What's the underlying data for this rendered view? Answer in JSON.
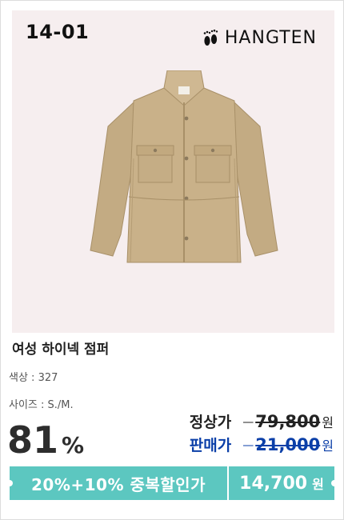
{
  "product": {
    "code": "14-01",
    "brand": "HANGTEN",
    "name": "여성 하이넥 점퍼",
    "color_label": "색상 : 327",
    "size_label": "사이즈 : S./M."
  },
  "pricing": {
    "discount_num": "81",
    "discount_unit": "%",
    "regular_label": "정상가",
    "regular_price": "79,800",
    "sale_label": "판매가",
    "sale_price": "21,000",
    "currency": "원"
  },
  "promo": {
    "text": "20%+10% 중복할인가",
    "final_price": "14,700",
    "currency": "원"
  },
  "colors": {
    "photo_bg": "#f6eeef",
    "jacket": "#c9b189",
    "accent": "#5cc7c0",
    "sale_blue": "#0b3fa8"
  },
  "icons": {
    "brand": "footprint-logo-icon"
  }
}
